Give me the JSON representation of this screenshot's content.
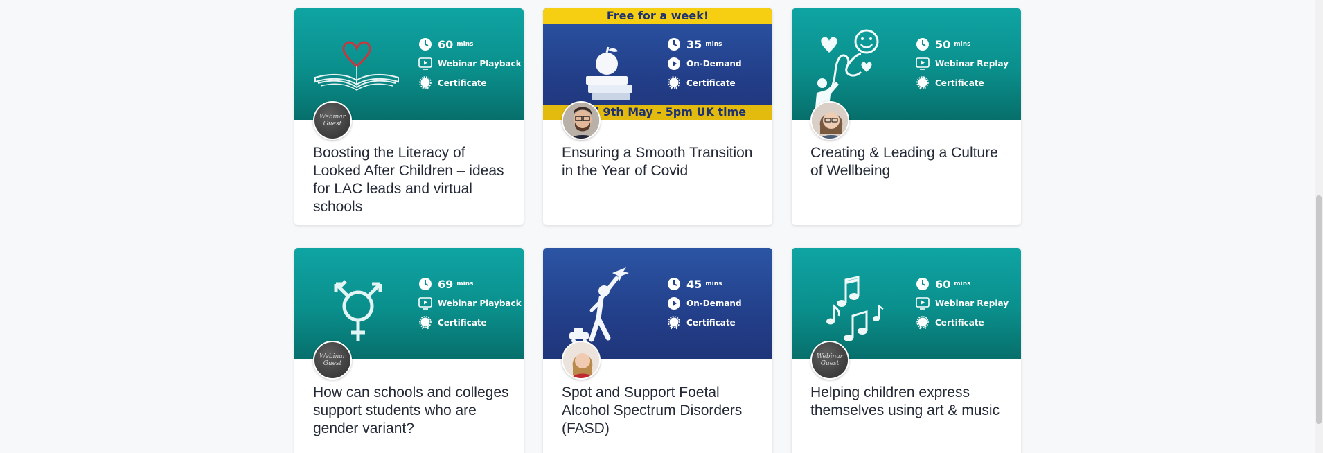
{
  "cards": [
    {
      "title": "Boosting the Literacy of Looked After Children – ideas for LAC leads and virtual schools",
      "duration": "60",
      "unit": "mins",
      "format": "Webinar Playback",
      "certificate": "Certificate",
      "theme": "teal",
      "art": "book-heart-icon",
      "avatar": "webinar-guest",
      "guest_label_1": "Webinar",
      "guest_label_2": "Guest"
    },
    {
      "title": "Ensuring a Smooth Transition in the Year of Covid",
      "duration": "35",
      "unit": "mins",
      "format": "On-Demand",
      "certificate": "Certificate",
      "theme": "navy",
      "art": "apple-books-icon",
      "avatar": "man-photo",
      "banner_top": "Free for a week!",
      "banner_bottom": "Until 9th May - 5pm UK time"
    },
    {
      "title": "Creating & Leading a Culture of Wellbeing",
      "duration": "50",
      "unit": "mins",
      "format": "Webinar Replay",
      "certificate": "Certificate",
      "theme": "teal",
      "art": "wellbeing-icon",
      "avatar": "woman-photo"
    },
    {
      "title": "How can schools and colleges support students who are gender variant?",
      "duration": "69",
      "unit": "mins",
      "format": "Webinar Playback",
      "certificate": "Certificate",
      "theme": "teal",
      "art": "transgender-symbol-icon",
      "avatar": "webinar-guest",
      "guest_label_1": "Webinar",
      "guest_label_2": "Guest"
    },
    {
      "title": "Spot and Support Foetal Alcohol Spectrum Disorders (FASD)",
      "duration": "45",
      "unit": "mins",
      "format": "On-Demand",
      "certificate": "Certificate",
      "theme": "navy",
      "art": "child-plane-icon",
      "avatar": "woman-red-photo"
    },
    {
      "title": "Helping children express themselves using art & music",
      "duration": "60",
      "unit": "mins",
      "format": "Webinar Replay",
      "certificate": "Certificate",
      "theme": "teal",
      "art": "music-notes-icon",
      "avatar": "webinar-guest",
      "guest_label_1": "Webinar",
      "guest_label_2": "Guest"
    }
  ]
}
